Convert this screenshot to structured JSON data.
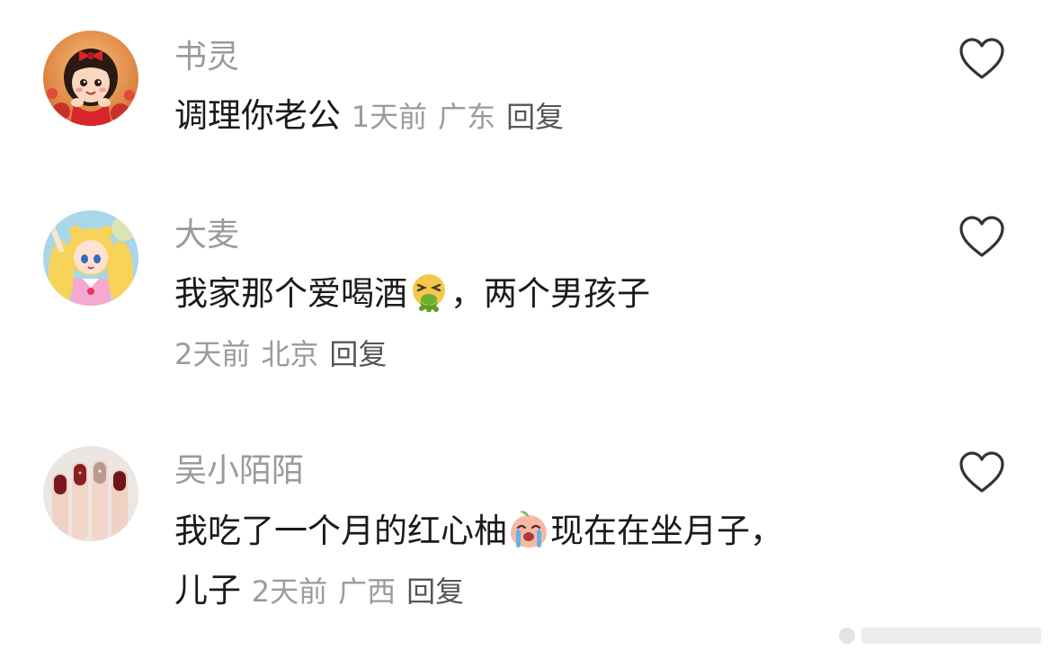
{
  "comments": [
    {
      "name": "书灵",
      "text": "调理你老公",
      "time": "1天前",
      "location": "广东",
      "reply": "回复"
    },
    {
      "name": "大麦",
      "text_before": "我家那个爱喝酒",
      "emoji": "vomiting-face-emoji",
      "text_after": "，两个男孩子",
      "time": "2天前",
      "location": "北京",
      "reply": "回复"
    },
    {
      "name": "吴小陌陌",
      "text_before": "我吃了一个月的红心柚",
      "emoji": "crying-peach-emoji",
      "text_after": "现在在坐月子，",
      "text_line2": "儿子",
      "time": "2天前",
      "location": "广西",
      "reply": "回复"
    }
  ],
  "icons": {
    "like": "heart-outline-icon"
  },
  "colors": {
    "name": "#9a9a9a",
    "text": "#1a1a1a",
    "meta": "#9b9b9b",
    "reply": "#555555"
  }
}
